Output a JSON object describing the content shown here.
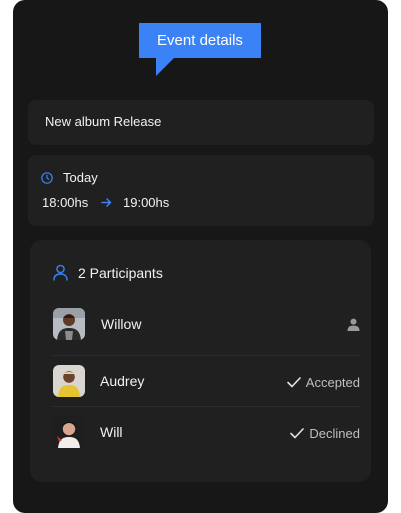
{
  "tooltip": {
    "label": "Event details"
  },
  "event": {
    "title": "New album Release",
    "day": "Today",
    "start_time": "18:00hs",
    "end_time": "19:00hs"
  },
  "participants": {
    "heading": "2 Participants",
    "items": [
      {
        "name": "Willow",
        "status": "",
        "status_icon": "user-icon"
      },
      {
        "name": "Audrey",
        "status": "Accepted",
        "status_icon": "check-icon"
      },
      {
        "name": "Will",
        "status": "Declined",
        "status_icon": "check-icon"
      }
    ]
  },
  "colors": {
    "background": "#171717",
    "card": "#202020",
    "accent": "#3b82f6",
    "text": "#f2f2f2",
    "muted": "#bfbfbf"
  }
}
